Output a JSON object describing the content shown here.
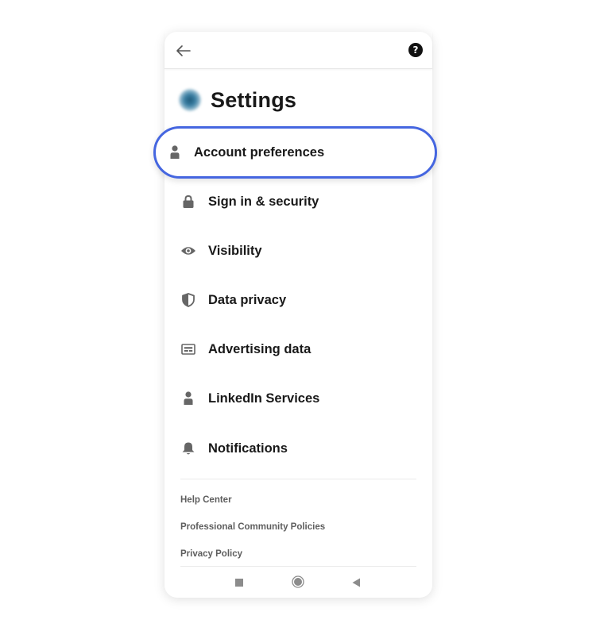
{
  "header": {
    "title": "Settings",
    "back_icon": "arrow-left-icon",
    "help_icon": "question-icon",
    "help_glyph": "?"
  },
  "menu": {
    "items": [
      {
        "label": "Account preferences",
        "icon": "person-icon",
        "highlighted": true
      },
      {
        "label": "Sign in & security",
        "icon": "lock-icon"
      },
      {
        "label": "Visibility",
        "icon": "eye-icon"
      },
      {
        "label": "Data privacy",
        "icon": "shield-icon"
      },
      {
        "label": "Advertising data",
        "icon": "ad-card-icon"
      },
      {
        "label": "LinkedIn Services",
        "icon": "person-icon"
      },
      {
        "label": "Notifications",
        "icon": "bell-icon"
      }
    ]
  },
  "footer": {
    "links": [
      "Help Center",
      "Professional Community Policies",
      "Privacy Policy"
    ]
  },
  "android_nav": {
    "recents_icon": "square-icon",
    "home_icon": "circle-icon",
    "back_icon": "triangle-back-icon"
  },
  "colors": {
    "highlight_border": "#4566e0",
    "text_primary": "#191919",
    "icon_gray": "#666666",
    "footer_text": "#5e5e5e"
  }
}
